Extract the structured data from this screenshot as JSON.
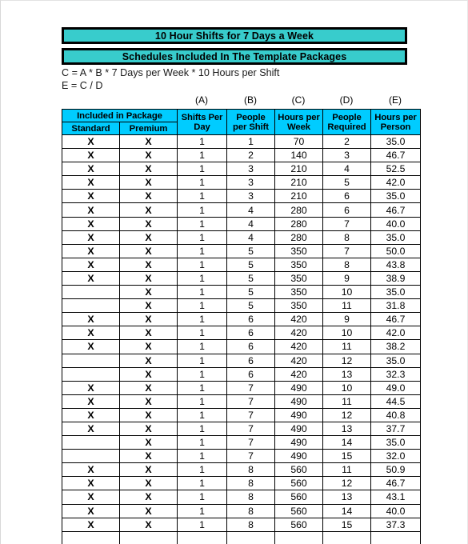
{
  "document": {
    "title_banner": "10 Hour Shifts for 7 Days a Week",
    "subtitle_banner": "Schedules Included In The Template Packages",
    "formula_c": "C = A * B * 7 Days per Week * 10 Hours per Shift",
    "formula_e": "E = C / D",
    "accent_banner_color": "#38cccc",
    "accent_header_color": "#00ccff"
  },
  "column_letters": [
    "(A)",
    "(B)",
    "(C)",
    "(D)",
    "(E)"
  ],
  "table": {
    "group_header": "Included in Package",
    "headers": {
      "standard": "Standard",
      "premium": "Premium",
      "shifts_per_day_line1": "Shifts Per",
      "shifts_per_day_line2": "Day",
      "people_per_shift_line1": "People",
      "people_per_shift_line2": "per Shift",
      "hours_per_week_line1": "Hours per",
      "hours_per_week_line2": "Week",
      "people_required_line1": "People",
      "people_required_line2": "Required",
      "hours_per_person_line1": "Hours per",
      "hours_per_person_line2": "Person"
    },
    "mark": "X",
    "rows": [
      {
        "standard": "X",
        "premium": "X",
        "shifts_per_day": "1",
        "people_per_shift": "1",
        "hours_per_week": "70",
        "people_required": "2",
        "hours_per_person": "35.0"
      },
      {
        "standard": "X",
        "premium": "X",
        "shifts_per_day": "1",
        "people_per_shift": "2",
        "hours_per_week": "140",
        "people_required": "3",
        "hours_per_person": "46.7"
      },
      {
        "standard": "X",
        "premium": "X",
        "shifts_per_day": "1",
        "people_per_shift": "3",
        "hours_per_week": "210",
        "people_required": "4",
        "hours_per_person": "52.5"
      },
      {
        "standard": "X",
        "premium": "X",
        "shifts_per_day": "1",
        "people_per_shift": "3",
        "hours_per_week": "210",
        "people_required": "5",
        "hours_per_person": "42.0"
      },
      {
        "standard": "X",
        "premium": "X",
        "shifts_per_day": "1",
        "people_per_shift": "3",
        "hours_per_week": "210",
        "people_required": "6",
        "hours_per_person": "35.0"
      },
      {
        "standard": "X",
        "premium": "X",
        "shifts_per_day": "1",
        "people_per_shift": "4",
        "hours_per_week": "280",
        "people_required": "6",
        "hours_per_person": "46.7"
      },
      {
        "standard": "X",
        "premium": "X",
        "shifts_per_day": "1",
        "people_per_shift": "4",
        "hours_per_week": "280",
        "people_required": "7",
        "hours_per_person": "40.0"
      },
      {
        "standard": "X",
        "premium": "X",
        "shifts_per_day": "1",
        "people_per_shift": "4",
        "hours_per_week": "280",
        "people_required": "8",
        "hours_per_person": "35.0"
      },
      {
        "standard": "X",
        "premium": "X",
        "shifts_per_day": "1",
        "people_per_shift": "5",
        "hours_per_week": "350",
        "people_required": "7",
        "hours_per_person": "50.0"
      },
      {
        "standard": "X",
        "premium": "X",
        "shifts_per_day": "1",
        "people_per_shift": "5",
        "hours_per_week": "350",
        "people_required": "8",
        "hours_per_person": "43.8"
      },
      {
        "standard": "X",
        "premium": "X",
        "shifts_per_day": "1",
        "people_per_shift": "5",
        "hours_per_week": "350",
        "people_required": "9",
        "hours_per_person": "38.9"
      },
      {
        "standard": "",
        "premium": "X",
        "shifts_per_day": "1",
        "people_per_shift": "5",
        "hours_per_week": "350",
        "people_required": "10",
        "hours_per_person": "35.0"
      },
      {
        "standard": "",
        "premium": "X",
        "shifts_per_day": "1",
        "people_per_shift": "5",
        "hours_per_week": "350",
        "people_required": "11",
        "hours_per_person": "31.8"
      },
      {
        "standard": "X",
        "premium": "X",
        "shifts_per_day": "1",
        "people_per_shift": "6",
        "hours_per_week": "420",
        "people_required": "9",
        "hours_per_person": "46.7"
      },
      {
        "standard": "X",
        "premium": "X",
        "shifts_per_day": "1",
        "people_per_shift": "6",
        "hours_per_week": "420",
        "people_required": "10",
        "hours_per_person": "42.0"
      },
      {
        "standard": "X",
        "premium": "X",
        "shifts_per_day": "1",
        "people_per_shift": "6",
        "hours_per_week": "420",
        "people_required": "11",
        "hours_per_person": "38.2"
      },
      {
        "standard": "",
        "premium": "X",
        "shifts_per_day": "1",
        "people_per_shift": "6",
        "hours_per_week": "420",
        "people_required": "12",
        "hours_per_person": "35.0"
      },
      {
        "standard": "",
        "premium": "X",
        "shifts_per_day": "1",
        "people_per_shift": "6",
        "hours_per_week": "420",
        "people_required": "13",
        "hours_per_person": "32.3"
      },
      {
        "standard": "X",
        "premium": "X",
        "shifts_per_day": "1",
        "people_per_shift": "7",
        "hours_per_week": "490",
        "people_required": "10",
        "hours_per_person": "49.0"
      },
      {
        "standard": "X",
        "premium": "X",
        "shifts_per_day": "1",
        "people_per_shift": "7",
        "hours_per_week": "490",
        "people_required": "11",
        "hours_per_person": "44.5"
      },
      {
        "standard": "X",
        "premium": "X",
        "shifts_per_day": "1",
        "people_per_shift": "7",
        "hours_per_week": "490",
        "people_required": "12",
        "hours_per_person": "40.8"
      },
      {
        "standard": "X",
        "premium": "X",
        "shifts_per_day": "1",
        "people_per_shift": "7",
        "hours_per_week": "490",
        "people_required": "13",
        "hours_per_person": "37.7"
      },
      {
        "standard": "",
        "premium": "X",
        "shifts_per_day": "1",
        "people_per_shift": "7",
        "hours_per_week": "490",
        "people_required": "14",
        "hours_per_person": "35.0"
      },
      {
        "standard": "",
        "premium": "X",
        "shifts_per_day": "1",
        "people_per_shift": "7",
        "hours_per_week": "490",
        "people_required": "15",
        "hours_per_person": "32.0"
      },
      {
        "standard": "X",
        "premium": "X",
        "shifts_per_day": "1",
        "people_per_shift": "8",
        "hours_per_week": "560",
        "people_required": "11",
        "hours_per_person": "50.9"
      },
      {
        "standard": "X",
        "premium": "X",
        "shifts_per_day": "1",
        "people_per_shift": "8",
        "hours_per_week": "560",
        "people_required": "12",
        "hours_per_person": "46.7"
      },
      {
        "standard": "X",
        "premium": "X",
        "shifts_per_day": "1",
        "people_per_shift": "8",
        "hours_per_week": "560",
        "people_required": "13",
        "hours_per_person": "43.1"
      },
      {
        "standard": "X",
        "premium": "X",
        "shifts_per_day": "1",
        "people_per_shift": "8",
        "hours_per_week": "560",
        "people_required": "14",
        "hours_per_person": "40.0"
      },
      {
        "standard": "X",
        "premium": "X",
        "shifts_per_day": "1",
        "people_per_shift": "8",
        "hours_per_week": "560",
        "people_required": "15",
        "hours_per_person": "37.3"
      }
    ]
  }
}
